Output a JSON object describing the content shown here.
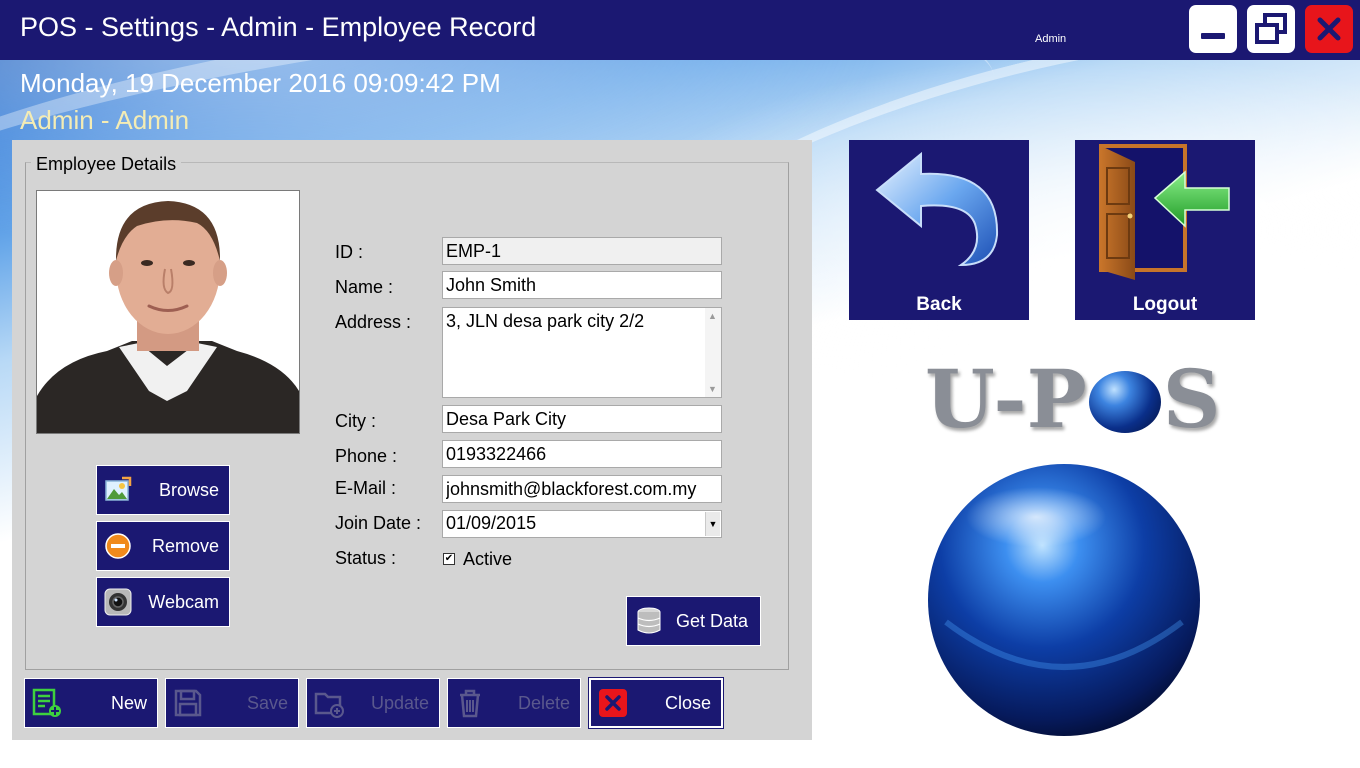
{
  "window": {
    "title": "POS - Settings - Admin - Employee Record",
    "user": "Admin"
  },
  "header": {
    "datetime": "Monday, 19 December 2016 09:09:42 PM",
    "user_line": "Admin - Admin"
  },
  "group": {
    "legend": "Employee Details"
  },
  "photo_buttons": [
    {
      "label": "Browse",
      "icon": "image-icon"
    },
    {
      "label": "Remove",
      "icon": "minus-circle-icon"
    },
    {
      "label": "Webcam",
      "icon": "webcam-icon"
    }
  ],
  "form": {
    "id_label": "ID :",
    "id_value": "EMP-1",
    "name_label": "Name :",
    "name_value": "John Smith",
    "address_label": "Address :",
    "address_value": "3, JLN desa park city 2/2",
    "city_label": "City :",
    "city_value": "Desa Park City",
    "phone_label": "Phone :",
    "phone_value": "0193322466",
    "email_label": "E-Mail :",
    "email_value": "johnsmith@blackforest.com.my",
    "join_label": "Join Date :",
    "join_value": "01/09/2015",
    "status_label": "Status :",
    "status_checkbox_label": "Active",
    "status_checked": true
  },
  "get_data": {
    "label": "Get Data",
    "icon": "database-icon"
  },
  "actions": [
    {
      "label": "New",
      "icon": "new-document-icon",
      "enabled": true
    },
    {
      "label": "Save",
      "icon": "save-icon",
      "enabled": false
    },
    {
      "label": "Update",
      "icon": "folder-add-icon",
      "enabled": false
    },
    {
      "label": "Delete",
      "icon": "trash-icon",
      "enabled": false
    },
    {
      "label": "Close",
      "icon": "close-icon",
      "enabled": true
    }
  ],
  "nav": {
    "back_label": "Back",
    "logout_label": "Logout"
  },
  "logo": {
    "text_left": "U-P",
    "text_right": "S"
  },
  "colors": {
    "titlebar": "#1b1872",
    "button": "#1b1872",
    "close_red": "#e8151b",
    "user_line": "#f4ecb4"
  }
}
